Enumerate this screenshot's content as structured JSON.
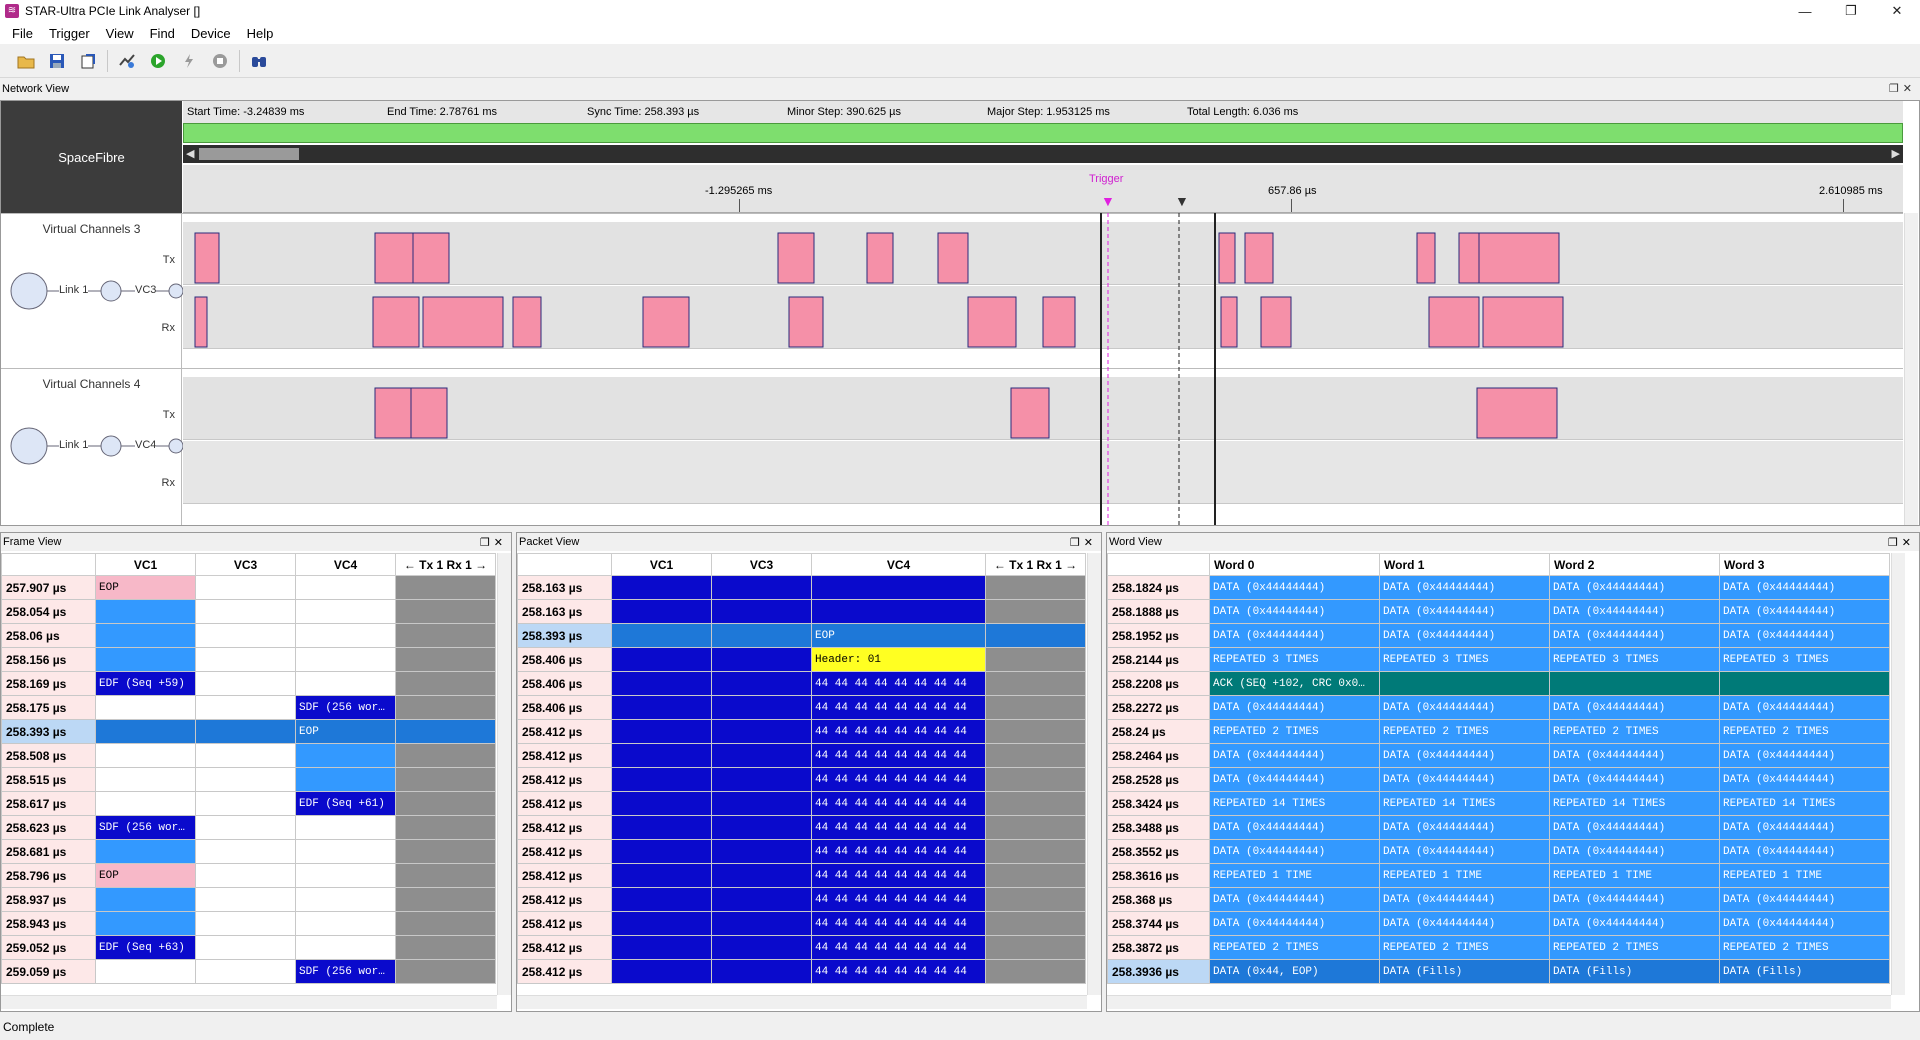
{
  "window": {
    "title": "STAR-Ultra PCIe Link Analyser []",
    "min": "—",
    "max": "❐",
    "close": "✕"
  },
  "menu": [
    "File",
    "Trigger",
    "View",
    "Find",
    "Device",
    "Help"
  ],
  "toolbar": [
    "open-icon",
    "save-icon",
    "export-icon",
    "configure-icon",
    "run-icon",
    "trigger-icon",
    "stop-icon",
    "find-icon"
  ],
  "network_view": {
    "panel_title": "Network View",
    "protocol": "SpaceFibre",
    "start_time": "Start Time: -3.24839 ms",
    "end_time": "End Time: 2.78761 ms",
    "sync_time": "Sync Time: 258.393 µs",
    "minor_step": "Minor Step: 390.625 µs",
    "major_step": "Major Step: 1.953125 ms",
    "total_length": "Total Length: 6.036 ms",
    "ruler_labels": [
      "-1.295265 ms",
      "657.86 µs",
      "2.610985 ms"
    ],
    "trigger_label": "Trigger",
    "groups": [
      {
        "name": "Virtual Channels 3",
        "link": "Link 1",
        "vc": "VC3",
        "tx": "Tx",
        "rx": "Rx"
      },
      {
        "name": "Virtual Channels 4",
        "link": "Link 1",
        "vc": "VC4",
        "tx": "Tx",
        "rx": "Rx"
      }
    ]
  },
  "frame_view": {
    "panel_title": "Frame View",
    "columns": [
      "",
      "VC1",
      "VC3",
      "VC4",
      "← Tx 1   Rx 1 →"
    ],
    "rows": [
      {
        "t": "257.907 µs",
        "c": [
          "EOP",
          "",
          "",
          ""
        ],
        "s": [
          "pink",
          "w",
          "w",
          "g"
        ]
      },
      {
        "t": "258.054 µs",
        "c": [
          "",
          "",
          "",
          ""
        ],
        "s": [
          "blue",
          "w",
          "w",
          "g"
        ]
      },
      {
        "t": "258.06 µs",
        "c": [
          "",
          "",
          "",
          ""
        ],
        "s": [
          "blue",
          "w",
          "w",
          "g"
        ]
      },
      {
        "t": "258.156 µs",
        "c": [
          "",
          "",
          "",
          ""
        ],
        "s": [
          "blue",
          "w",
          "w",
          "g"
        ]
      },
      {
        "t": "258.169 µs",
        "c": [
          "EDF (Seq +59)",
          "",
          "",
          ""
        ],
        "s": [
          "navy",
          "w",
          "w",
          "g"
        ]
      },
      {
        "t": "258.175 µs",
        "c": [
          "",
          "",
          "SDF (256 wor…",
          ""
        ],
        "s": [
          "w",
          "w",
          "navy",
          "g"
        ]
      },
      {
        "t": "258.393 µs",
        "c": [
          "",
          "",
          "EOP",
          ""
        ],
        "s": [
          "sel",
          "sel",
          "sel",
          "sel"
        ],
        "sel": true
      },
      {
        "t": "258.508 µs",
        "c": [
          "",
          "",
          "",
          ""
        ],
        "s": [
          "w",
          "w",
          "blue",
          "g"
        ]
      },
      {
        "t": "258.515 µs",
        "c": [
          "",
          "",
          "",
          ""
        ],
        "s": [
          "w",
          "w",
          "blue",
          "g"
        ]
      },
      {
        "t": "258.617 µs",
        "c": [
          "",
          "",
          "EDF (Seq +61)",
          ""
        ],
        "s": [
          "w",
          "w",
          "navy",
          "g"
        ]
      },
      {
        "t": "258.623 µs",
        "c": [
          "SDF (256 wor…",
          "",
          "",
          ""
        ],
        "s": [
          "navy",
          "w",
          "w",
          "g"
        ]
      },
      {
        "t": "258.681 µs",
        "c": [
          "",
          "",
          "",
          ""
        ],
        "s": [
          "blue",
          "w",
          "w",
          "g"
        ]
      },
      {
        "t": "258.796 µs",
        "c": [
          "EOP",
          "",
          "",
          ""
        ],
        "s": [
          "pink",
          "w",
          "w",
          "g"
        ]
      },
      {
        "t": "258.937 µs",
        "c": [
          "",
          "",
          "",
          ""
        ],
        "s": [
          "blue",
          "w",
          "w",
          "g"
        ]
      },
      {
        "t": "258.943 µs",
        "c": [
          "",
          "",
          "",
          ""
        ],
        "s": [
          "blue",
          "w",
          "w",
          "g"
        ]
      },
      {
        "t": "259.052 µs",
        "c": [
          "EDF (Seq +63)",
          "",
          "",
          ""
        ],
        "s": [
          "navy",
          "w",
          "w",
          "g"
        ]
      },
      {
        "t": "259.059 µs",
        "c": [
          "",
          "",
          "SDF (256 wor…",
          ""
        ],
        "s": [
          "w",
          "w",
          "navy",
          "g"
        ]
      }
    ]
  },
  "packet_view": {
    "panel_title": "Packet View",
    "columns": [
      "",
      "VC1",
      "VC3",
      "VC4",
      "← Tx 1   Rx 1 →"
    ],
    "rows": [
      {
        "t": "258.163 µs",
        "c": "",
        "s": "navy"
      },
      {
        "t": "258.163 µs",
        "c": "",
        "s": "navy"
      },
      {
        "t": "258.393 µs",
        "c": "EOP",
        "s": "sel",
        "sel": true
      },
      {
        "t": "258.406 µs",
        "c": "Header: 01",
        "s": "yellow"
      },
      {
        "t": "258.406 µs",
        "c": "44 44 44 44 44 44 44 44",
        "s": "navy"
      },
      {
        "t": "258.406 µs",
        "c": "44 44 44 44 44 44 44 44",
        "s": "navy"
      },
      {
        "t": "258.412 µs",
        "c": "44 44 44 44 44 44 44 44",
        "s": "navy"
      },
      {
        "t": "258.412 µs",
        "c": "44 44 44 44 44 44 44 44",
        "s": "navy"
      },
      {
        "t": "258.412 µs",
        "c": "44 44 44 44 44 44 44 44",
        "s": "navy"
      },
      {
        "t": "258.412 µs",
        "c": "44 44 44 44 44 44 44 44",
        "s": "navy"
      },
      {
        "t": "258.412 µs",
        "c": "44 44 44 44 44 44 44 44",
        "s": "navy"
      },
      {
        "t": "258.412 µs",
        "c": "44 44 44 44 44 44 44 44",
        "s": "navy"
      },
      {
        "t": "258.412 µs",
        "c": "44 44 44 44 44 44 44 44",
        "s": "navy"
      },
      {
        "t": "258.412 µs",
        "c": "44 44 44 44 44 44 44 44",
        "s": "navy"
      },
      {
        "t": "258.412 µs",
        "c": "44 44 44 44 44 44 44 44",
        "s": "navy"
      },
      {
        "t": "258.412 µs",
        "c": "44 44 44 44 44 44 44 44",
        "s": "navy"
      },
      {
        "t": "258.412 µs",
        "c": "44 44 44 44 44 44 44 44",
        "s": "navy"
      }
    ]
  },
  "word_view": {
    "panel_title": "Word View",
    "columns": [
      "",
      "Word 0",
      "Word 1",
      "Word 2",
      "Word 3"
    ],
    "rows": [
      {
        "t": "258.1824 µs",
        "w": [
          "DATA (0x44444444)",
          "DATA (0x44444444)",
          "DATA (0x44444444)",
          "DATA (0x44444444)"
        ],
        "s": "blue"
      },
      {
        "t": "258.1888 µs",
        "w": [
          "DATA (0x44444444)",
          "DATA (0x44444444)",
          "DATA (0x44444444)",
          "DATA (0x44444444)"
        ],
        "s": "blue"
      },
      {
        "t": "258.1952 µs",
        "w": [
          "DATA (0x44444444)",
          "DATA (0x44444444)",
          "DATA (0x44444444)",
          "DATA (0x44444444)"
        ],
        "s": "blue"
      },
      {
        "t": "258.2144 µs",
        "w": [
          "REPEATED 3 TIMES",
          "REPEATED 3 TIMES",
          "REPEATED 3 TIMES",
          "REPEATED 3 TIMES"
        ],
        "s": "blue"
      },
      {
        "t": "258.2208 µs",
        "w": [
          "ACK (SEQ +102, CRC 0x0…",
          "",
          "",
          ""
        ],
        "s": "teal"
      },
      {
        "t": "258.2272 µs",
        "w": [
          "DATA (0x44444444)",
          "DATA (0x44444444)",
          "DATA (0x44444444)",
          "DATA (0x44444444)"
        ],
        "s": "blue"
      },
      {
        "t": "258.24 µs",
        "w": [
          "REPEATED 2 TIMES",
          "REPEATED 2 TIMES",
          "REPEATED 2 TIMES",
          "REPEATED 2 TIMES"
        ],
        "s": "blue"
      },
      {
        "t": "258.2464 µs",
        "w": [
          "DATA (0x44444444)",
          "DATA (0x44444444)",
          "DATA (0x44444444)",
          "DATA (0x44444444)"
        ],
        "s": "blue"
      },
      {
        "t": "258.2528 µs",
        "w": [
          "DATA (0x44444444)",
          "DATA (0x44444444)",
          "DATA (0x44444444)",
          "DATA (0x44444444)"
        ],
        "s": "blue"
      },
      {
        "t": "258.3424 µs",
        "w": [
          "REPEATED 14 TIMES",
          "REPEATED 14 TIMES",
          "REPEATED 14 TIMES",
          "REPEATED 14 TIMES"
        ],
        "s": "blue"
      },
      {
        "t": "258.3488 µs",
        "w": [
          "DATA (0x44444444)",
          "DATA (0x44444444)",
          "DATA (0x44444444)",
          "DATA (0x44444444)"
        ],
        "s": "blue"
      },
      {
        "t": "258.3552 µs",
        "w": [
          "DATA (0x44444444)",
          "DATA (0x44444444)",
          "DATA (0x44444444)",
          "DATA (0x44444444)"
        ],
        "s": "blue"
      },
      {
        "t": "258.3616 µs",
        "w": [
          "REPEATED 1 TIME",
          "REPEATED 1 TIME",
          "REPEATED 1 TIME",
          "REPEATED 1 TIME"
        ],
        "s": "blue"
      },
      {
        "t": "258.368 µs",
        "w": [
          "DATA (0x44444444)",
          "DATA (0x44444444)",
          "DATA (0x44444444)",
          "DATA (0x44444444)"
        ],
        "s": "blue"
      },
      {
        "t": "258.3744 µs",
        "w": [
          "DATA (0x44444444)",
          "DATA (0x44444444)",
          "DATA (0x44444444)",
          "DATA (0x44444444)"
        ],
        "s": "blue"
      },
      {
        "t": "258.3872 µs",
        "w": [
          "REPEATED 2 TIMES",
          "REPEATED 2 TIMES",
          "REPEATED 2 TIMES",
          "REPEATED 2 TIMES"
        ],
        "s": "blue"
      },
      {
        "t": "258.3936 µs",
        "w": [
          "DATA (0x44, EOP)",
          "DATA (Fills)",
          "DATA (Fills)",
          "DATA (Fills)"
        ],
        "s": "sel",
        "sel": true
      }
    ]
  },
  "status": "Complete",
  "colors": {
    "pink": "#f7b8c8",
    "blue": "#3399ff",
    "navy": "#0a0acc",
    "sel": "#1e78d8",
    "selrow": "#bcd8f5",
    "teal": "#007a78",
    "yellow": "#ffff22",
    "grey": "#8e8e8e",
    "bars": "#f590a8",
    "green": "#7ede6e"
  }
}
